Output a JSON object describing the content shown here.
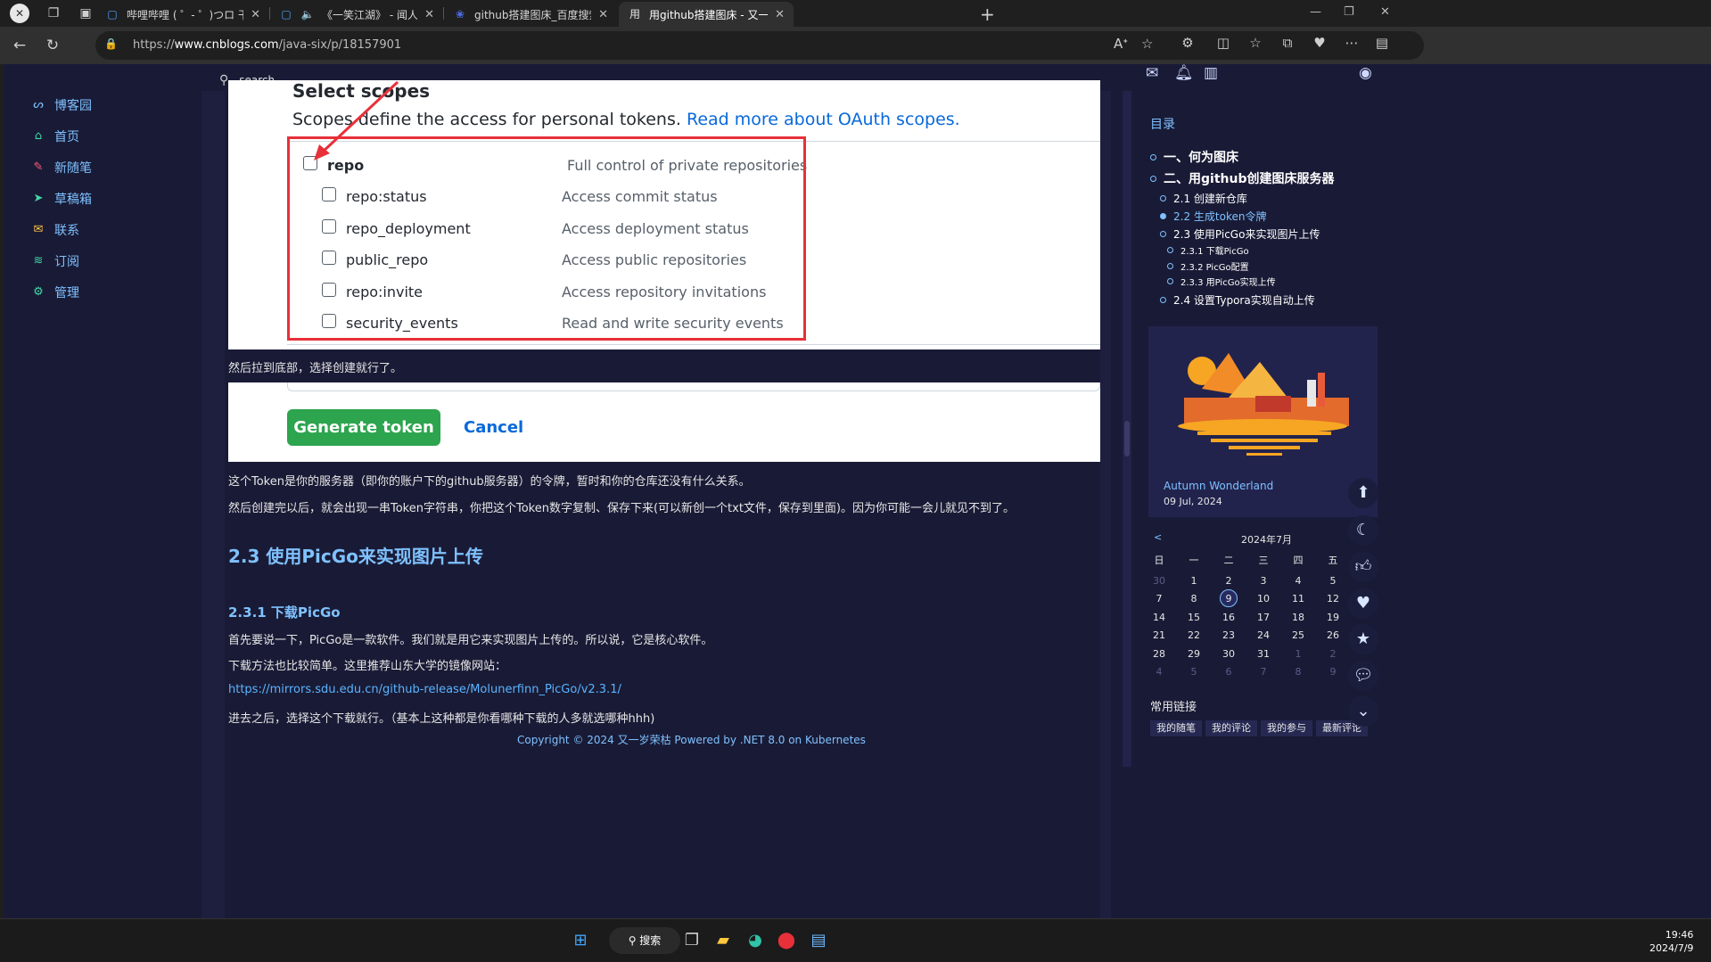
{
  "browser": {
    "tabs": [
      {
        "title": "哔哩哔哩 ( ゜- ゜)つロ 干杯~-bilibili",
        "active": false
      },
      {
        "title": "《一笑江湖》 - 闻人听書_ 哔",
        "active": false
      },
      {
        "title": "github搭建图床_百度搜索",
        "active": false
      },
      {
        "title": "用github搭建图床 - 又一岁荣枯",
        "active": true
      }
    ],
    "url_prefix": "https://",
    "url_host": "www.cnblogs.com",
    "url_path": "/java-six/p/18157901"
  },
  "left_nav": {
    "items": [
      {
        "label": "博客园",
        "icon": "cnblogs-icon"
      },
      {
        "label": "首页",
        "icon": "home-icon"
      },
      {
        "label": "新随笔",
        "icon": "new-post-icon"
      },
      {
        "label": "草稿箱",
        "icon": "drafts-icon"
      },
      {
        "label": "联系",
        "icon": "mail-icon"
      },
      {
        "label": "订阅",
        "icon": "rss-icon"
      },
      {
        "label": "管理",
        "icon": "gear-icon"
      }
    ]
  },
  "search": {
    "placeholder": "search..."
  },
  "github_scopes": {
    "title": "Select scopes",
    "desc": "Scopes define the access for personal tokens.",
    "desc_link": "Read more about OAuth scopes.",
    "rows": [
      {
        "name": "repo",
        "desc": "Full control of private repositories"
      },
      {
        "name": "repo:status",
        "desc": "Access commit status"
      },
      {
        "name": "repo_deployment",
        "desc": "Access deployment status"
      },
      {
        "name": "public_repo",
        "desc": "Access public repositories"
      },
      {
        "name": "repo:invite",
        "desc": "Access repository invitations"
      },
      {
        "name": "security_events",
        "desc": "Read and write security events"
      }
    ]
  },
  "article": {
    "p1": "然后拉到底部，选择创建就行了。",
    "generate_label": "Generate token",
    "cancel_label": "Cancel",
    "p2": "这个Token是你的服务器（即你的账户下的github服务器）的令牌，暂时和你的仓库还没有什么关系。",
    "p3": "然后创建完以后，就会出现一串Token字符串，你把这个Token数字复制、保存下来(可以新创一个txt文件，保存到里面)。因为你可能一会儿就见不到了。",
    "h23": "2.3 使用PicGo来实现图片上传",
    "h231": "2.3.1 下载PicGo",
    "p4": "首先要说一下，PicGo是一款软件。我们就是用它来实现图片上传的。所以说，它是核心软件。",
    "p5": "下载方法也比较简单。这里推荐山东大学的镜像网站：",
    "link": "https://mirrors.sdu.edu.cn/github-release/Molunerfinn_PicGo/v2.3.1/",
    "p6": "进去之后，选择这个下载就行。（基本上这种都是你看哪种下载的人多就选哪种hhh)",
    "copyright": "Copyright © 2024 又一岁荣枯   Powered by .NET 8.0 on Kubernetes"
  },
  "toc": {
    "title": "目录",
    "items": [
      {
        "label": "一、何为图床",
        "level": 1,
        "active": false
      },
      {
        "label": "二、用github创建图床服务器",
        "level": 1,
        "active": false
      },
      {
        "label": "2.1 创建新仓库",
        "level": 2,
        "active": false
      },
      {
        "label": "2.2 生成token令牌",
        "level": 2,
        "active": true
      },
      {
        "label": "2.3 使用PicGo来实现图片上传",
        "level": 2,
        "active": false
      },
      {
        "label": "2.3.1 下载PicGo",
        "level": 3,
        "active": false
      },
      {
        "label": "2.3.2 PicGo配置",
        "level": 3,
        "active": false
      },
      {
        "label": "2.3.3 用PicGo实现上传",
        "level": 3,
        "active": false
      },
      {
        "label": "2.4 设置Typora实现自动上传",
        "level": 2,
        "active": false
      }
    ]
  },
  "profile_card": {
    "name": "Autumn Wonderland",
    "date": "09 Jul, 2024"
  },
  "calendar": {
    "prev": "<",
    "title": "2024年7月",
    "weekdays": [
      "日",
      "一",
      "二",
      "三",
      "四",
      "五"
    ],
    "rows": [
      [
        "30",
        "1",
        "2",
        "3",
        "4",
        "5"
      ],
      [
        "7",
        "8",
        "9",
        "10",
        "11",
        "12"
      ],
      [
        "14",
        "15",
        "16",
        "17",
        "18",
        "19"
      ],
      [
        "21",
        "22",
        "23",
        "24",
        "25",
        "26"
      ],
      [
        "28",
        "29",
        "30",
        "31",
        "1",
        "2"
      ],
      [
        "4",
        "5",
        "6",
        "7",
        "8",
        "9"
      ]
    ],
    "today": "9"
  },
  "links": {
    "title": "常用链接",
    "items": [
      "我的随笔",
      "我的评论",
      "我的参与",
      "最新评论"
    ]
  },
  "taskbar": {
    "search_label": "搜索",
    "time": "19:46",
    "date": "2024/7/9"
  },
  "colors": {
    "accent": "#7fc1ff",
    "page_bg": "#191b36",
    "github_green": "#2da44e",
    "highlight_red": "#e8303a"
  }
}
